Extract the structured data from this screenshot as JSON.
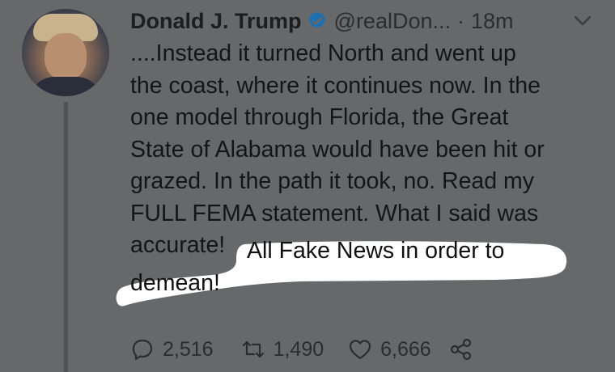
{
  "tweet": {
    "author_name": "Donald J. Trump",
    "handle": "@realDon...",
    "time_sep": "·",
    "time": "18m",
    "text_lines": [
      "....Instead it turned North and went up",
      "the coast, where it continues now. In the",
      "one model through Florida, the Great",
      "State of Alabama would have been hit or",
      "grazed. In the path it took, no. Read my",
      "FULL FEMA statement. What I said was",
      "accurate!"
    ],
    "highlighted_line_1": "All Fake News in order to",
    "highlighted_line_2": "demean!"
  },
  "actions": {
    "replies": "2,516",
    "retweets": "1,490",
    "likes": "6,666"
  },
  "icons": {
    "verified": "verified-badge-icon",
    "menu": "chevron-down-icon",
    "reply": "reply-icon",
    "retweet": "retweet-icon",
    "like": "heart-icon",
    "share": "share-icon"
  },
  "colors": {
    "background": "#67686a",
    "verified": "#1e6fb0",
    "highlight": "#ffffff"
  }
}
